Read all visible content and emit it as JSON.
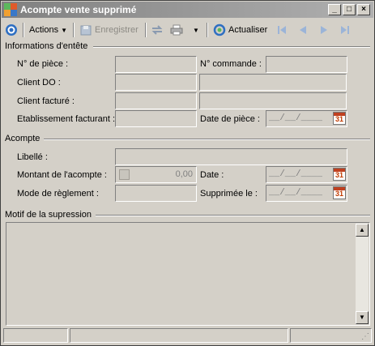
{
  "window": {
    "title": "Acompte vente supprimé",
    "controls": [
      "_",
      "□",
      "×"
    ]
  },
  "toolbar": {
    "actions_label": "Actions",
    "save_label": "Enregistrer",
    "refresh_label": "Actualiser"
  },
  "header_section": {
    "title": "Informations d'entête",
    "piece_no_label": "N° de pièce :",
    "order_no_label": "N° commande :",
    "client_do_label": "Client DO :",
    "billed_client_label": "Client facturé :",
    "billing_establishment_label": "Etablissement facturant :",
    "piece_date_label": "Date de pièce :",
    "piece_date_value": "__/__/____",
    "calendar_day": "31"
  },
  "deposit_section": {
    "title": "Acompte",
    "label_label": "Libellé :",
    "amount_label": "Montant de l'acompte :",
    "amount_value": "0,00",
    "date_label": "Date :",
    "date_value": "__/__/____",
    "payment_mode_label": "Mode de règlement :",
    "deleted_on_label": "Supprimée le :",
    "deleted_on_value": "__/__/____",
    "calendar_day": "31"
  },
  "reason_section": {
    "title": "Motif de la supression"
  }
}
